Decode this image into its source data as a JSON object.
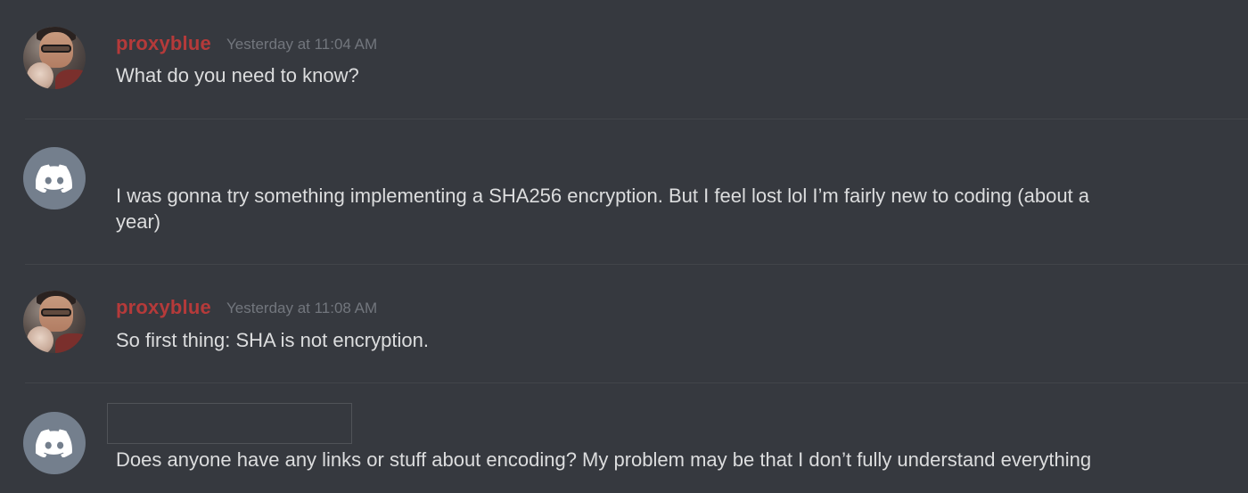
{
  "messages": [
    {
      "author": "proxyblue",
      "timestamp": "Yesterday at 11:04 AM",
      "avatar": "user-photo-avatar",
      "text": "What do you need to know?"
    },
    {
      "author": "",
      "timestamp": "",
      "avatar": "discord-default-avatar",
      "text_line1": "I was gonna try something implementing a SHA256 encryption. But I feel lost lol I’m fairly new to coding (about a",
      "text_line2": "year)"
    },
    {
      "author": "proxyblue",
      "timestamp": "Yesterday at 11:08 AM",
      "avatar": "user-photo-avatar",
      "text": "So first thing: SHA is not encryption."
    },
    {
      "author": "",
      "timestamp": "",
      "avatar": "discord-default-avatar",
      "text": "Does anyone have any links or stuff about encoding?  My problem may be that I don’t fully understand everything"
    }
  ],
  "colors": {
    "background": "#36393f",
    "username": "#b53a3a",
    "timestamp": "#72767d",
    "text": "#dcddde",
    "default_avatar": "#747f8d",
    "divider": "#42454a"
  }
}
